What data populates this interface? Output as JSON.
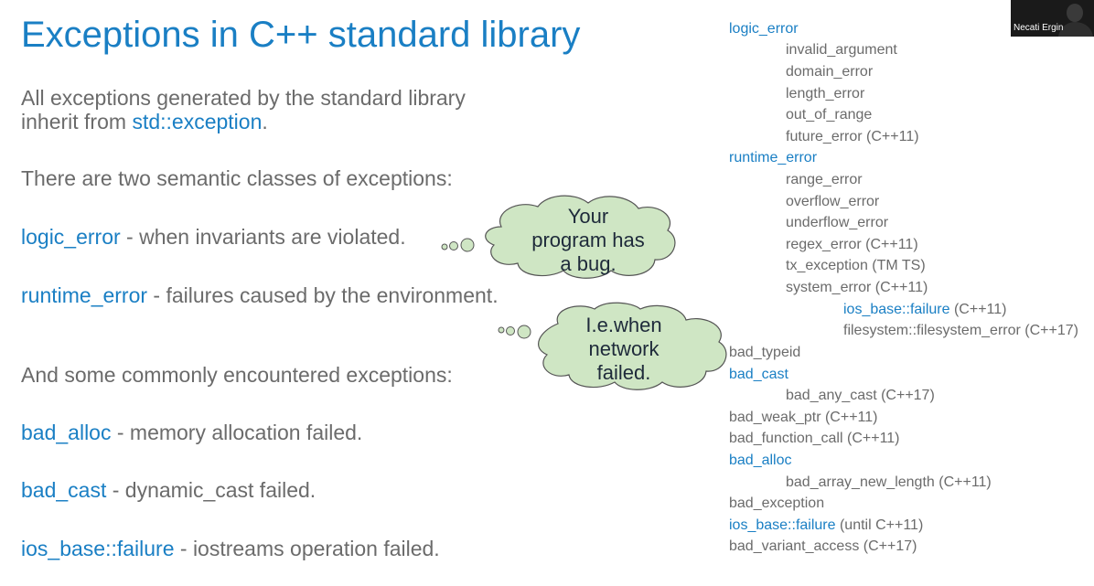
{
  "slide": {
    "title": "Exceptions in C++ standard library",
    "intro_line1": "All exceptions generated by the standard library",
    "intro_line2_pre": "inherit from ",
    "intro_line2_link": "std::exception",
    "intro_line2_post": ".",
    "semantic_heading": "There are two semantic classes of exceptions:",
    "items": [
      {
        "term": "logic_error",
        "desc": " - when invariants are violated."
      },
      {
        "term": "runtime_error",
        "desc": " - failures caused by the environment."
      }
    ],
    "common_heading": "And some commonly encountered exceptions:",
    "common": [
      {
        "term": "bad_alloc",
        "desc": " - memory allocation failed."
      },
      {
        "term": "bad_cast",
        "desc": " - dynamic_cast failed."
      },
      {
        "term": "ios_base::failure",
        "desc": " - iostreams operation failed."
      }
    ]
  },
  "callouts": [
    {
      "lines": [
        "Your",
        "program has",
        "a bug."
      ]
    },
    {
      "lines": [
        "I.e.when",
        "network",
        "failed."
      ]
    }
  ],
  "hierarchy": [
    {
      "name": "logic_error",
      "note": "",
      "link": true
    },
    {
      "name": "invalid_argument",
      "note": "",
      "link": false
    },
    {
      "name": "domain_error",
      "note": "",
      "link": false
    },
    {
      "name": "length_error",
      "note": "",
      "link": false
    },
    {
      "name": "out_of_range",
      "note": "",
      "link": false
    },
    {
      "name": "future_error",
      "note": " (C++11)",
      "link": false
    },
    {
      "name": "runtime_error",
      "note": "",
      "link": true
    },
    {
      "name": "range_error",
      "note": "",
      "link": false
    },
    {
      "name": "overflow_error",
      "note": "",
      "link": false
    },
    {
      "name": "underflow_error",
      "note": "",
      "link": false
    },
    {
      "name": "regex_error",
      "note": " (C++11)",
      "link": false
    },
    {
      "name": "tx_exception",
      "note": " (TM TS)",
      "link": false
    },
    {
      "name": "system_error",
      "note": " (C++11)",
      "link": false
    },
    {
      "name": "ios_base::failure",
      "note": " (C++11)",
      "link": true
    },
    {
      "name": "filesystem::filesystem_error",
      "note": " (C++17)",
      "link": false
    },
    {
      "name": "bad_typeid",
      "note": "",
      "link": false
    },
    {
      "name": "bad_cast",
      "note": "",
      "link": true
    },
    {
      "name": "bad_any_cast",
      "note": " (C++17)",
      "link": false
    },
    {
      "name": "bad_weak_ptr",
      "note": " (C++11)",
      "link": false
    },
    {
      "name": "bad_function_call",
      "note": " (C++11)",
      "link": false
    },
    {
      "name": "bad_alloc",
      "note": "",
      "link": true
    },
    {
      "name": "bad_array_new_length",
      "note": " (C++11)",
      "link": false
    },
    {
      "name": "bad_exception",
      "note": "",
      "link": false
    },
    {
      "name": "ios_base::failure",
      "note": " (until C++11)",
      "link": true
    },
    {
      "name": "bad_variant_access",
      "note": " (C++17)",
      "link": false
    }
  ],
  "webcam": {
    "name": "Necati Ergin"
  },
  "colors": {
    "accent": "#1a7fc4",
    "text": "#6b6b6b",
    "cloud_fill": "#cfe6c4",
    "cloud_stroke": "#555555"
  }
}
